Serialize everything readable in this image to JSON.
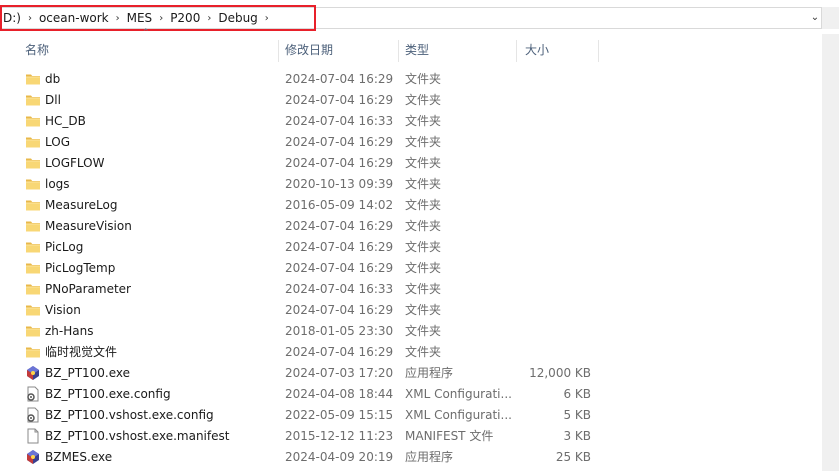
{
  "address": {
    "crumbs": [
      "D:)",
      "ocean-work",
      "MES",
      "P200",
      "Debug"
    ],
    "separator": "›",
    "dropdown_icon": "chevron-down-icon"
  },
  "columns": {
    "name": "名称",
    "date": "修改日期",
    "type": "类型",
    "size": "大小"
  },
  "files": [
    {
      "name": "db",
      "date": "2024-07-04  16:29",
      "type": "文件夹",
      "size": "",
      "icon": "folder"
    },
    {
      "name": "Dll",
      "date": "2024-07-04  16:29",
      "type": "文件夹",
      "size": "",
      "icon": "folder"
    },
    {
      "name": "HC_DB",
      "date": "2024-07-04  16:33",
      "type": "文件夹",
      "size": "",
      "icon": "folder"
    },
    {
      "name": "LOG",
      "date": "2024-07-04  16:29",
      "type": "文件夹",
      "size": "",
      "icon": "folder"
    },
    {
      "name": "LOGFLOW",
      "date": "2024-07-04  16:29",
      "type": "文件夹",
      "size": "",
      "icon": "folder"
    },
    {
      "name": "logs",
      "date": "2020-10-13  09:39",
      "type": "文件夹",
      "size": "",
      "icon": "folder"
    },
    {
      "name": "MeasureLog",
      "date": "2016-05-09  14:02",
      "type": "文件夹",
      "size": "",
      "icon": "folder"
    },
    {
      "name": "MeasureVision",
      "date": "2024-07-04  16:29",
      "type": "文件夹",
      "size": "",
      "icon": "folder"
    },
    {
      "name": "PicLog",
      "date": "2024-07-04  16:29",
      "type": "文件夹",
      "size": "",
      "icon": "folder"
    },
    {
      "name": "PicLogTemp",
      "date": "2024-07-04  16:29",
      "type": "文件夹",
      "size": "",
      "icon": "folder"
    },
    {
      "name": "PNoParameter",
      "date": "2024-07-04  16:33",
      "type": "文件夹",
      "size": "",
      "icon": "folder"
    },
    {
      "name": "Vision",
      "date": "2024-07-04  16:29",
      "type": "文件夹",
      "size": "",
      "icon": "folder"
    },
    {
      "name": "zh-Hans",
      "date": "2018-01-05  23:30",
      "type": "文件夹",
      "size": "",
      "icon": "folder"
    },
    {
      "name": "临时视觉文件",
      "date": "2024-07-04  16:29",
      "type": "文件夹",
      "size": "",
      "icon": "folder"
    },
    {
      "name": "BZ_PT100.exe",
      "date": "2024-07-03  17:20",
      "type": "应用程序",
      "size": "12,000 KB",
      "icon": "exe"
    },
    {
      "name": "BZ_PT100.exe.config",
      "date": "2024-04-08  18:44",
      "type": "XML Configurati...",
      "size": "6 KB",
      "icon": "config"
    },
    {
      "name": "BZ_PT100.vshost.exe.config",
      "date": "2022-05-09  15:15",
      "type": "XML Configurati...",
      "size": "5 KB",
      "icon": "config"
    },
    {
      "name": "BZ_PT100.vshost.exe.manifest",
      "date": "2015-12-12  11:23",
      "type": "MANIFEST 文件",
      "size": "3 KB",
      "icon": "file"
    },
    {
      "name": "BZMES.exe",
      "date": "2024-04-09  20:19",
      "type": "应用程序",
      "size": "25 KB",
      "icon": "exe"
    }
  ],
  "colors": {
    "highlight": "#e8202a",
    "folder": "#f8d775",
    "header_text": "#4c607a"
  }
}
